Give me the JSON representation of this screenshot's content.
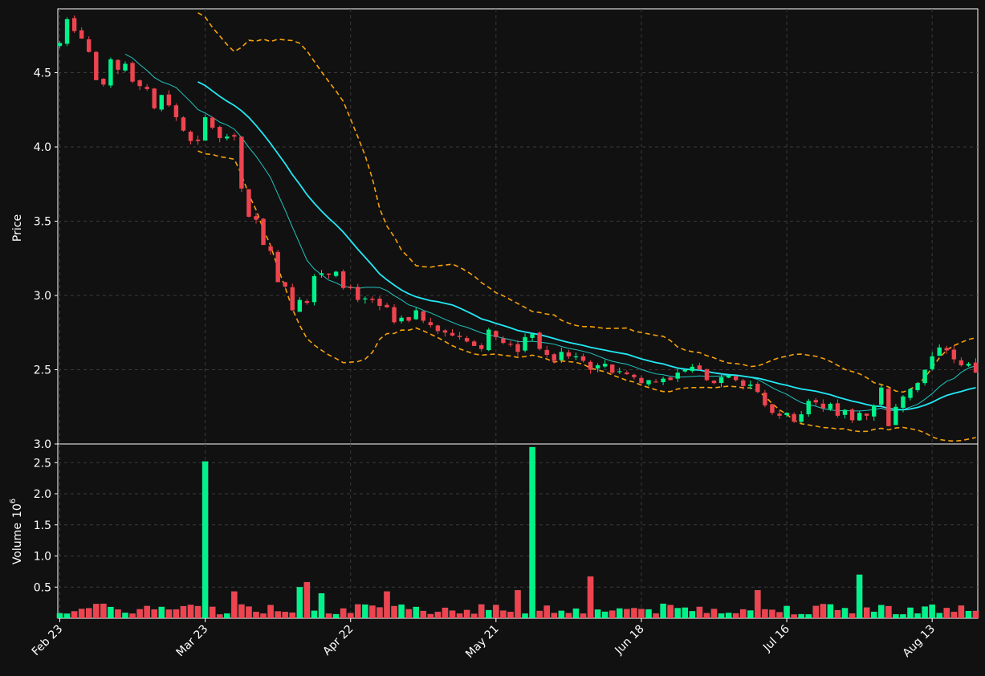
{
  "chart_data": {
    "type": "candlestick",
    "theme": {
      "background": "#111111",
      "up_color": "#00f28a",
      "down_color": "#ee4450",
      "ma_fast_color": "#20c5c0",
      "ma_slow_color": "#22e8f5",
      "band_color": "#f5a10a",
      "grid_color": "#3a3a3a",
      "text_color": "#ffffff"
    },
    "ylabel_price": "Price",
    "ylabel_volume": "Volume",
    "volume_exponent": "10",
    "volume_exponent_power": "6",
    "price_ylim": [
      2.0,
      4.93
    ],
    "price_yticks": [
      {
        "v": 2.0,
        "label": "3.0"
      },
      {
        "v": 2.5,
        "label": "2.5"
      },
      {
        "v": 3.0,
        "label": "3.0"
      },
      {
        "v": 3.5,
        "label": "3.5"
      },
      {
        "v": 4.0,
        "label": "4.0"
      },
      {
        "v": 4.5,
        "label": "4.5"
      }
    ],
    "volume_ylim": [
      0,
      2.8
    ],
    "volume_yticks": [
      "0.5",
      "1.0",
      "1.5",
      "2.0",
      "2.5"
    ],
    "x_ticks": [
      {
        "i": 0,
        "label": "Feb 23"
      },
      {
        "i": 20,
        "label": "Mar 23"
      },
      {
        "i": 40,
        "label": "Apr 22"
      },
      {
        "i": 60,
        "label": "May 21"
      },
      {
        "i": 80,
        "label": "Jun 18"
      },
      {
        "i": 100,
        "label": "Jul 16"
      },
      {
        "i": 120,
        "label": "Aug 13"
      }
    ],
    "n_bars": 127,
    "closes": [
      4.7,
      4.86,
      4.78,
      4.73,
      4.64,
      4.45,
      4.42,
      4.59,
      4.52,
      4.56,
      4.44,
      4.41,
      4.39,
      4.26,
      4.35,
      4.28,
      4.2,
      4.11,
      4.04,
      4.04,
      4.2,
      4.13,
      4.06,
      4.07,
      4.07,
      3.72,
      3.53,
      3.51,
      3.34,
      3.3,
      3.09,
      3.06,
      2.9,
      2.97,
      2.95,
      3.13,
      3.15,
      3.14,
      3.16,
      3.05,
      3.05,
      2.97,
      2.98,
      2.97,
      2.93,
      2.92,
      2.82,
      2.85,
      2.83,
      2.9,
      2.83,
      2.8,
      2.76,
      2.75,
      2.73,
      2.72,
      2.69,
      2.66,
      2.64,
      2.77,
      2.72,
      2.68,
      2.67,
      2.62,
      2.72,
      2.74,
      2.64,
      2.6,
      2.56,
      2.62,
      2.59,
      2.59,
      2.56,
      2.5,
      2.53,
      2.54,
      2.48,
      2.49,
      2.47,
      2.45,
      2.41,
      2.43,
      2.42,
      2.44,
      2.43,
      2.48,
      2.5,
      2.52,
      2.5,
      2.43,
      2.41,
      2.45,
      2.46,
      2.43,
      2.39,
      2.4,
      2.35,
      2.26,
      2.21,
      2.19,
      2.21,
      2.15,
      2.2,
      2.29,
      2.28,
      2.24,
      2.27,
      2.19,
      2.23,
      2.16,
      2.21,
      2.19,
      2.26,
      2.38,
      2.12,
      2.25,
      2.32,
      2.37,
      2.41,
      2.5,
      2.59,
      2.65,
      2.63,
      2.57,
      2.53,
      2.54,
      2.48
    ]
  }
}
